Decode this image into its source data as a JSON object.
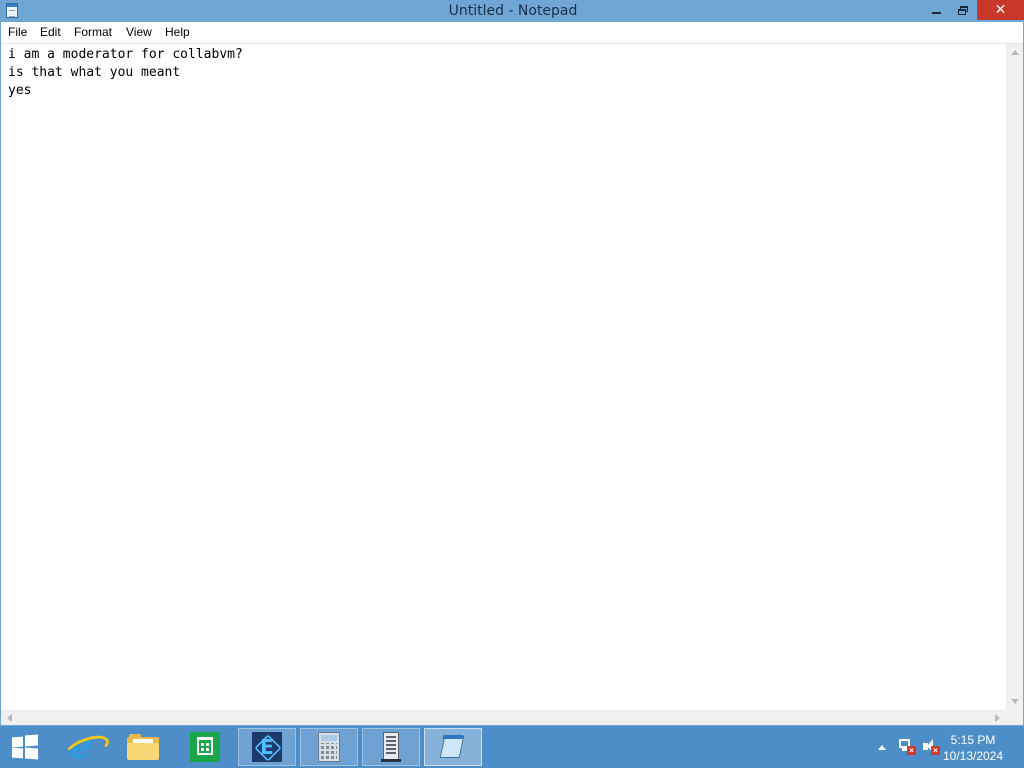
{
  "window": {
    "title": "Untitled - Notepad",
    "close_glyph": "✕"
  },
  "menu": {
    "items": [
      {
        "label": "File"
      },
      {
        "label": "Edit"
      },
      {
        "label": "Format"
      },
      {
        "label": "View"
      },
      {
        "label": "Help"
      }
    ]
  },
  "editor": {
    "lines": [
      "i am a moderator for collabvm?",
      "is that what you meant",
      "yes"
    ]
  },
  "taskbar": {
    "apps": [
      {
        "name": "internet-explorer-icon",
        "state": "pinned"
      },
      {
        "name": "file-explorer-icon",
        "state": "pinned"
      },
      {
        "name": "store-icon",
        "state": "pinned"
      },
      {
        "name": "hex-app-icon",
        "state": "running"
      },
      {
        "name": "calculator-icon",
        "state": "running"
      },
      {
        "name": "server-manager-icon",
        "state": "running"
      },
      {
        "name": "notepad-icon",
        "state": "active"
      }
    ],
    "clock": {
      "time": "5:15 PM",
      "date": "10/13/2024"
    }
  },
  "colors": {
    "titlebar": "#6fa6d4",
    "close_button": "#c7382a",
    "taskbar": "#4d8ec8"
  }
}
